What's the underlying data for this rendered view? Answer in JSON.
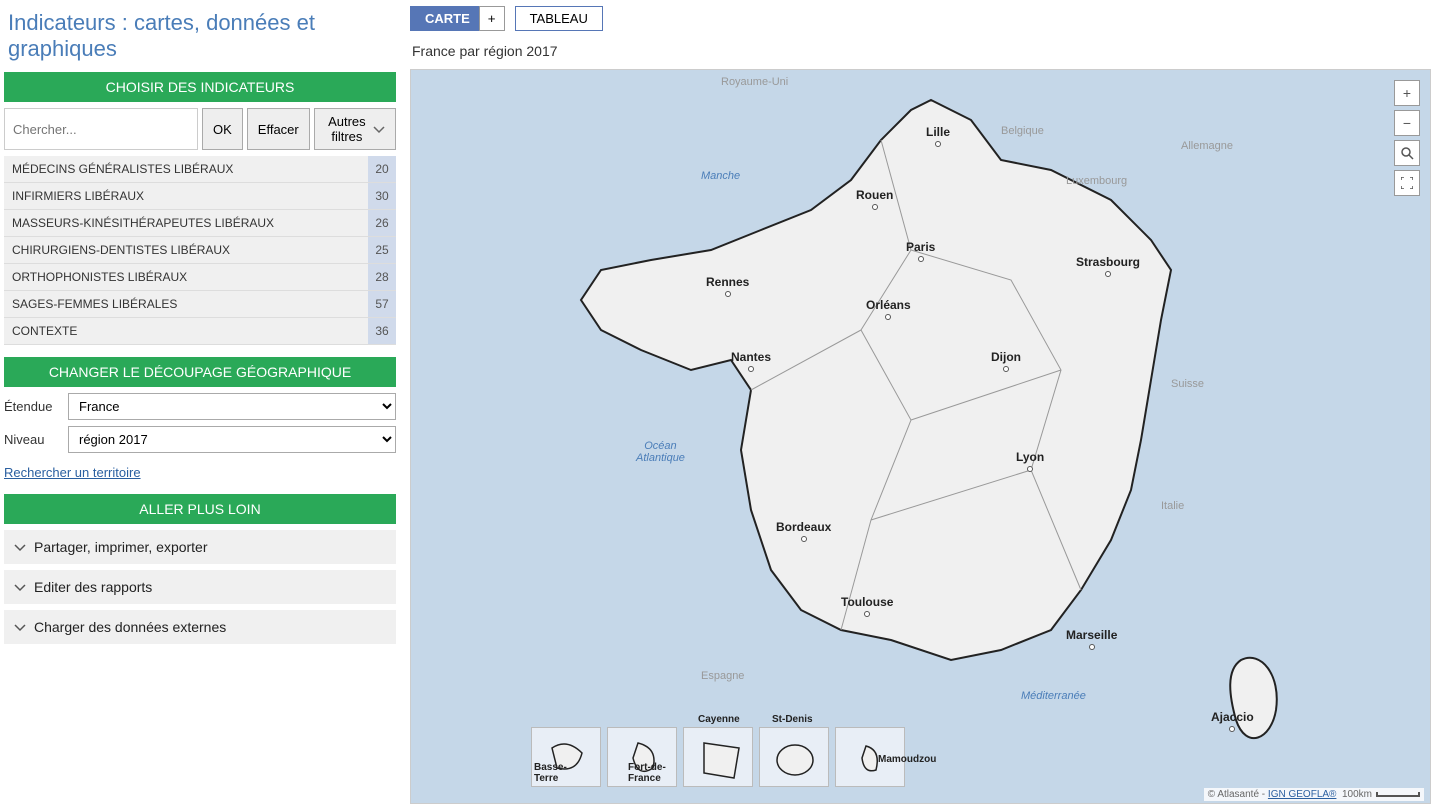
{
  "page_title": "Indicateurs : cartes, données et graphiques",
  "toolbar": {
    "carte": "CARTE",
    "plus": "+",
    "tableau": "TABLEAU"
  },
  "section_headers": {
    "indicators": "CHOISIR DES INDICATEURS",
    "geo": "CHANGER LE DÉCOUPAGE GÉOGRAPHIQUE",
    "more": "ALLER PLUS LOIN"
  },
  "search": {
    "placeholder": "Chercher...",
    "ok": "OK",
    "clear": "Effacer",
    "other_filters": "Autres filtres"
  },
  "indicators": [
    {
      "label": "MÉDECINS GÉNÉRALISTES LIBÉRAUX",
      "count": 20
    },
    {
      "label": "INFIRMIERS LIBÉRAUX",
      "count": 30
    },
    {
      "label": "MASSEURS-KINÉSITHÉRAPEUTES LIBÉRAUX",
      "count": 26
    },
    {
      "label": "CHIRURGIENS-DENTISTES LIBÉRAUX",
      "count": 25
    },
    {
      "label": "ORTHOPHONISTES LIBÉRAUX",
      "count": 28
    },
    {
      "label": "SAGES-FEMMES LIBÉRALES",
      "count": 57
    },
    {
      "label": "CONTEXTE",
      "count": 36
    }
  ],
  "geo": {
    "extent_label": "Étendue",
    "extent_value": "France",
    "level_label": "Niveau",
    "level_value": "région 2017",
    "search_territory": "Rechercher un territoire"
  },
  "accordion": [
    "Partager, imprimer, exporter",
    "Editer des rapports",
    "Charger des données externes"
  ],
  "map": {
    "title": "France par région 2017",
    "attribution_prefix": "© Atlasanté - ",
    "attribution_link": "IGN GEOFLA®",
    "scale_label": "100km",
    "seas": {
      "manche": "Manche",
      "atlantique": "Océan\nAtlantique",
      "mediterranee": "Méditerranée"
    },
    "countries": {
      "uk": "Royaume-Uni",
      "belgium": "Belgique",
      "germany": "Allemagne",
      "luxembourg": "Luxembourg",
      "switzerland": "Suisse",
      "italy": "Italie",
      "spain": "Espagne"
    },
    "cities": {
      "lille": "Lille",
      "rouen": "Rouen",
      "paris": "Paris",
      "strasbourg": "Strasbourg",
      "rennes": "Rennes",
      "orleans": "Orléans",
      "nantes": "Nantes",
      "dijon": "Dijon",
      "lyon": "Lyon",
      "bordeaux": "Bordeaux",
      "toulouse": "Toulouse",
      "marseille": "Marseille",
      "ajaccio": "Ajaccio"
    },
    "insets": {
      "basse_terre": "Basse-\nTerre",
      "fort_de_france": "Fort-de-\nFrance",
      "cayenne": "Cayenne",
      "st_denis": "St-Denis",
      "mamoudzou": "Mamoudzou"
    }
  }
}
